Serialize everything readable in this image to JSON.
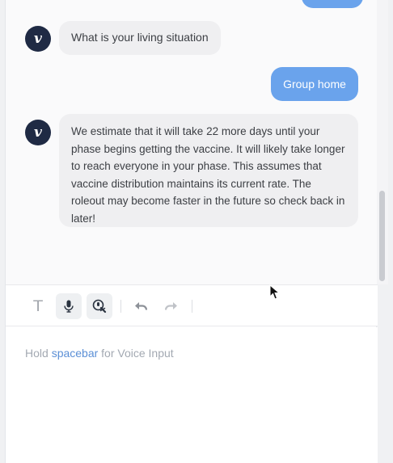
{
  "chat": {
    "bot_avatar_letter": "v",
    "messages": [
      {
        "from": "bot",
        "text": "What is your living situation"
      },
      {
        "from": "user",
        "text": "Group home"
      },
      {
        "from": "bot",
        "text": "We estimate that it will take 22 more days until your phase begins getting the vaccine. It will likely take longer to reach everyone in your phase. This assumes that vaccine distribution maintains its current rate. The roleout may become faster in the future so check back in later!"
      }
    ]
  },
  "toolbar": {
    "text_tool_label": "T",
    "icons": [
      "text-icon",
      "microphone-icon",
      "voice-chat-icon",
      "undo-icon",
      "redo-icon"
    ]
  },
  "input": {
    "hint_prefix": "Hold ",
    "hint_key": "spacebar",
    "hint_suffix": " for Voice Input"
  },
  "colors": {
    "user_bubble": "#6aa3ec",
    "bot_bubble": "#efeff1",
    "avatar": "#1f2a44",
    "link_blue": "#5b8fd6"
  }
}
